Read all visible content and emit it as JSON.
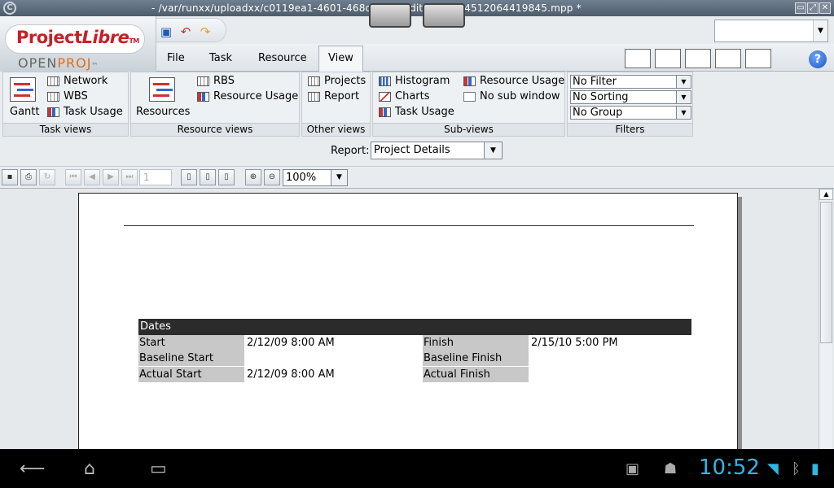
{
  "window": {
    "title": "- /var/runxx/uploadxx/c0119ea1-4601-468c                b5             fb/editproject14512064419845.mpp *",
    "app_icon": "C",
    "buttons": [
      "▭",
      "⤢",
      "✕"
    ]
  },
  "logo": {
    "project": "Project",
    "libre": "Libre",
    "tm": "TM",
    "openproj_open": "OPEN",
    "openproj_proj": "PROJ",
    "openproj_tm": "™"
  },
  "menu": {
    "tabs": [
      {
        "label": "File"
      },
      {
        "label": "Task"
      },
      {
        "label": "Resource"
      },
      {
        "label": "View"
      }
    ]
  },
  "help_label": "?",
  "ribbon": {
    "task_views": {
      "label": "Task views",
      "gantt": "Gantt",
      "network": "Network",
      "wbs": "WBS",
      "task_usage": "Task Usage"
    },
    "resource_views": {
      "label": "Resource views",
      "resources": "Resources",
      "rbs": "RBS",
      "resource_usage": "Resource Usage"
    },
    "other_views": {
      "label": "Other views",
      "projects": "Projects",
      "report": "Report"
    },
    "sub_views": {
      "label": "Sub-views",
      "histogram": "Histogram",
      "charts": "Charts",
      "task_usage": "Task Usage",
      "resource_usage": "Resource Usage",
      "no_sub_window": "No sub window"
    },
    "filters": {
      "label": "Filters",
      "filter": "No Filter",
      "sorting": "No Sorting",
      "group": "No Group"
    }
  },
  "report": {
    "label": "Report:",
    "selected": "Project Details"
  },
  "preview_toolbar": {
    "page": "1",
    "zoom": "100%"
  },
  "document": {
    "section": "Dates",
    "rows": [
      {
        "left_label": "Start",
        "left_value": "2/12/09 8:00 AM",
        "right_label": "Finish",
        "right_value": "2/15/10 5:00 PM"
      },
      {
        "left_label": "Baseline Start",
        "left_value": "",
        "right_label": "Baseline Finish",
        "right_value": ""
      },
      {
        "left_label": "Actual Start",
        "left_value": "2/12/09 8:00 AM",
        "right_label": "Actual Finish",
        "right_value": ""
      }
    ]
  },
  "status_bar": {
    "time": "10:52"
  },
  "colors": {
    "accent_blue": "#33b5e5",
    "brand_red": "#c62027",
    "dates_header": "#2b2b2b"
  }
}
